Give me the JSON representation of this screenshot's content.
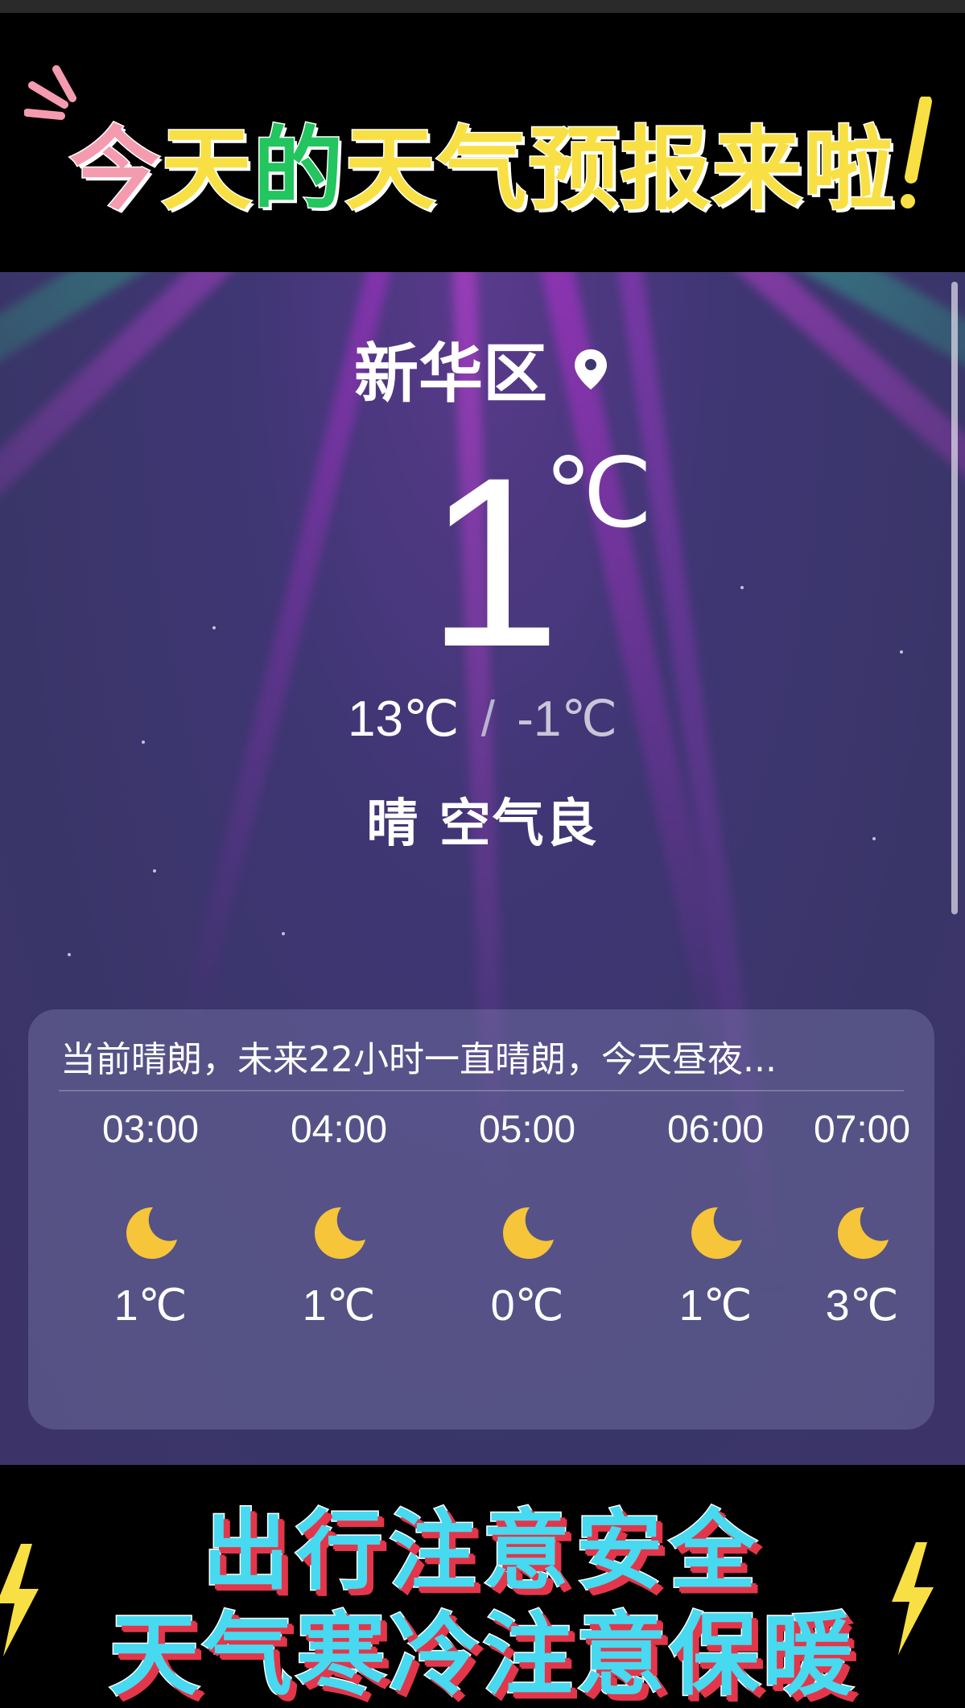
{
  "banner": {
    "headline_chars": [
      {
        "ch": "今",
        "color": "#f59bb0"
      },
      {
        "ch": "天",
        "color": "#f8e044"
      },
      {
        "ch": "的",
        "color": "#22c55e"
      },
      {
        "ch": "天",
        "color": "#f8e044"
      },
      {
        "ch": "气",
        "color": "#f8e044"
      },
      {
        "ch": "预",
        "color": "#f8e044"
      },
      {
        "ch": "报",
        "color": "#f8e044"
      },
      {
        "ch": "来",
        "color": "#f8e044"
      },
      {
        "ch": "啦",
        "color": "#f8e044"
      }
    ]
  },
  "weather": {
    "location": "新华区",
    "location_icon": "location-pin-icon",
    "current_temp": "1",
    "temp_unit": "℃",
    "high": "13℃",
    "separator": "/",
    "low": "-1℃",
    "condition": "晴 空气良"
  },
  "forecast": {
    "summary": "当前晴朗，未来22小时一直晴朗，今天昼夜...",
    "hours": [
      {
        "time": "03:00",
        "icon": "moon-icon",
        "temp": "1℃"
      },
      {
        "time": "04:00",
        "icon": "moon-icon",
        "temp": "1℃"
      },
      {
        "time": "05:00",
        "icon": "moon-icon",
        "temp": "0℃"
      },
      {
        "time": "06:00",
        "icon": "moon-icon",
        "temp": "1℃"
      },
      {
        "time": "07:00",
        "icon": "moon-icon",
        "temp": "3℃"
      }
    ]
  },
  "footer": {
    "line1": "出行注意安全",
    "line2": "天气寒冷注意保暖",
    "text_color": "#47d9f0",
    "shadow_color": "#e3364a"
  }
}
